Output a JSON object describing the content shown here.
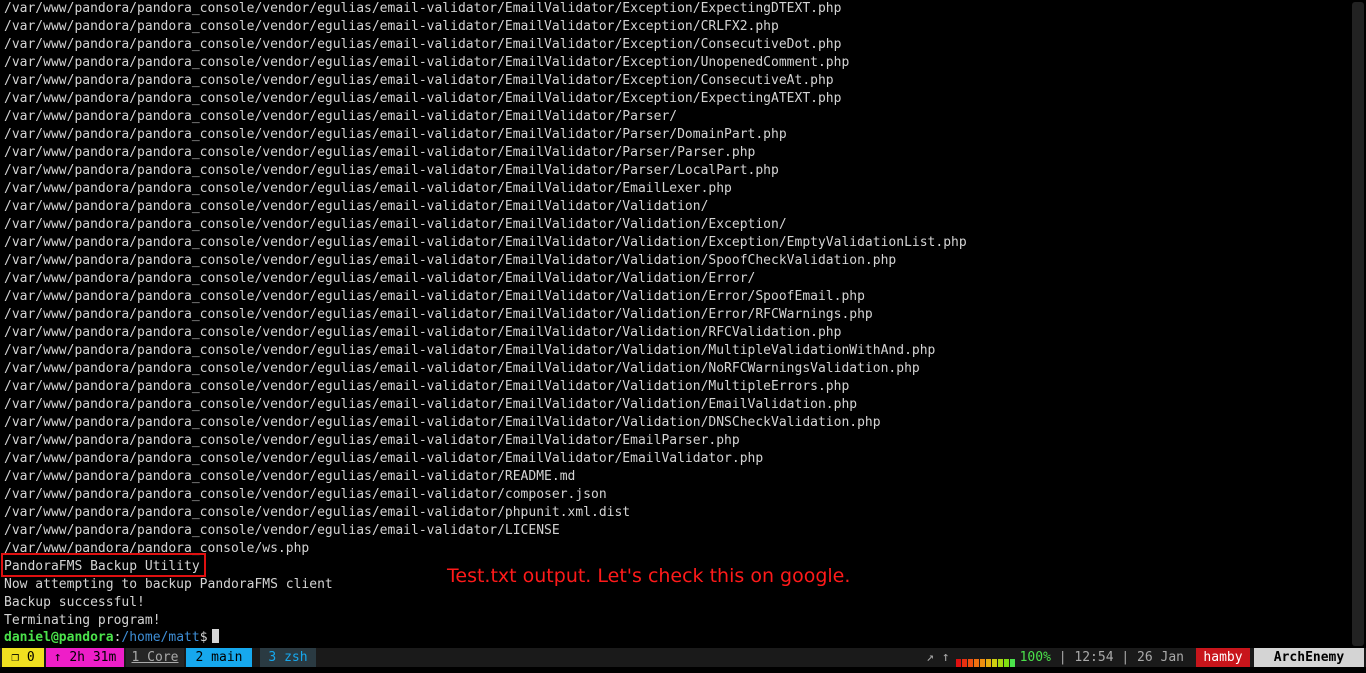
{
  "terminal": {
    "output_lines": [
      "/var/www/pandora/pandora_console/vendor/egulias/email-validator/EmailValidator/Exception/ExpectingDTEXT.php",
      "/var/www/pandora/pandora_console/vendor/egulias/email-validator/EmailValidator/Exception/CRLFX2.php",
      "/var/www/pandora/pandora_console/vendor/egulias/email-validator/EmailValidator/Exception/ConsecutiveDot.php",
      "/var/www/pandora/pandora_console/vendor/egulias/email-validator/EmailValidator/Exception/UnopenedComment.php",
      "/var/www/pandora/pandora_console/vendor/egulias/email-validator/EmailValidator/Exception/ConsecutiveAt.php",
      "/var/www/pandora/pandora_console/vendor/egulias/email-validator/EmailValidator/Exception/ExpectingATEXT.php",
      "/var/www/pandora/pandora_console/vendor/egulias/email-validator/EmailValidator/Parser/",
      "/var/www/pandora/pandora_console/vendor/egulias/email-validator/EmailValidator/Parser/DomainPart.php",
      "/var/www/pandora/pandora_console/vendor/egulias/email-validator/EmailValidator/Parser/Parser.php",
      "/var/www/pandora/pandora_console/vendor/egulias/email-validator/EmailValidator/Parser/LocalPart.php",
      "/var/www/pandora/pandora_console/vendor/egulias/email-validator/EmailValidator/EmailLexer.php",
      "/var/www/pandora/pandora_console/vendor/egulias/email-validator/EmailValidator/Validation/",
      "/var/www/pandora/pandora_console/vendor/egulias/email-validator/EmailValidator/Validation/Exception/",
      "/var/www/pandora/pandora_console/vendor/egulias/email-validator/EmailValidator/Validation/Exception/EmptyValidationList.php",
      "/var/www/pandora/pandora_console/vendor/egulias/email-validator/EmailValidator/Validation/SpoofCheckValidation.php",
      "/var/www/pandora/pandora_console/vendor/egulias/email-validator/EmailValidator/Validation/Error/",
      "/var/www/pandora/pandora_console/vendor/egulias/email-validator/EmailValidator/Validation/Error/SpoofEmail.php",
      "/var/www/pandora/pandora_console/vendor/egulias/email-validator/EmailValidator/Validation/Error/RFCWarnings.php",
      "/var/www/pandora/pandora_console/vendor/egulias/email-validator/EmailValidator/Validation/RFCValidation.php",
      "/var/www/pandora/pandora_console/vendor/egulias/email-validator/EmailValidator/Validation/MultipleValidationWithAnd.php",
      "/var/www/pandora/pandora_console/vendor/egulias/email-validator/EmailValidator/Validation/NoRFCWarningsValidation.php",
      "/var/www/pandora/pandora_console/vendor/egulias/email-validator/EmailValidator/Validation/MultipleErrors.php",
      "/var/www/pandora/pandora_console/vendor/egulias/email-validator/EmailValidator/Validation/EmailValidation.php",
      "/var/www/pandora/pandora_console/vendor/egulias/email-validator/EmailValidator/Validation/DNSCheckValidation.php",
      "/var/www/pandora/pandora_console/vendor/egulias/email-validator/EmailValidator/EmailParser.php",
      "/var/www/pandora/pandora_console/vendor/egulias/email-validator/EmailValidator/EmailValidator.php",
      "/var/www/pandora/pandora_console/vendor/egulias/email-validator/README.md",
      "/var/www/pandora/pandora_console/vendor/egulias/email-validator/composer.json",
      "/var/www/pandora/pandora_console/vendor/egulias/email-validator/phpunit.xml.dist",
      "/var/www/pandora/pandora_console/vendor/egulias/email-validator/LICENSE",
      "/var/www/pandora/pandora_console/ws.php",
      "PandoraFMS Backup Utility",
      "Now attempting to backup PandoraFMS client",
      "Backup successful!",
      "Terminating program!"
    ],
    "prompt": {
      "user_host": "daniel@pandora",
      "separator": ":",
      "path": "/home/matt",
      "symbol": "$"
    }
  },
  "annotation": {
    "text": "Test.txt output. Let's check this on google.",
    "color": "#ff1a1a"
  },
  "statusbar": {
    "session": "❐ 0",
    "uptime": "↑ 2h 31m",
    "windows": [
      {
        "label": "1 Core",
        "active": false
      },
      {
        "label": "2 main",
        "active": true
      },
      {
        "label": "3 zsh",
        "active": false
      }
    ],
    "arrow": "↗ ↑",
    "battery_percent": "100%",
    "battery_level": 1.0,
    "time": "12:54",
    "date": "26 Jan",
    "sep": "|",
    "hostname": "hamby",
    "theme": "ArchEnemy"
  },
  "colors": {
    "background": "#000000",
    "text": "#d4d4d4",
    "prompt_user": "#4be24b",
    "prompt_path": "#3e8ed6",
    "session_bg": "#f0e020",
    "uptime_bg": "#ee1ec8",
    "active_window_bg": "#16a8ee",
    "hostname_bg": "#c8151b"
  }
}
